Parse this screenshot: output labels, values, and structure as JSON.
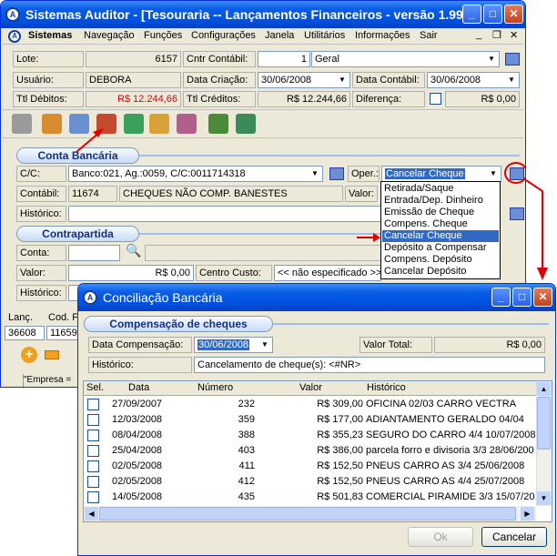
{
  "main": {
    "title": "Sistemas Auditor - [Tesouraria -- Lançamentos Financeiros - versão 1.99]",
    "menu": [
      "Sistemas",
      "Navegação",
      "Funções",
      "Configurações",
      "Janela",
      "Utilitários",
      "Informações",
      "Sair"
    ],
    "lote_label": "Lote:",
    "lote_value": "6157",
    "cntr_label": "Cntr Contábil:",
    "cntr_num": "1",
    "cntr_value": "Geral",
    "usuario_label": "Usuário:",
    "usuario_value": "DEBORA",
    "criacao_label": "Data Criação:",
    "criacao_value": "30/06/2008",
    "contabil_date_label": "Data Contábil:",
    "contabil_date_value": "30/06/2008",
    "debitos_label": "Ttl Débitos:",
    "debitos_value": "R$ 12.244,66",
    "creditos_label": "Ttl Créditos:",
    "creditos_value": "R$ 12.244,66",
    "diferenca_label": "Diferença:",
    "diferenca_value": "R$ 0,00",
    "conta_bancaria_title": "Conta Bancária",
    "cc_label": "C/C:",
    "cc_value": "Banco:021, Ag.:0059, C/C:0011714318",
    "oper_label": "Oper.:",
    "oper_value": "Cancelar Cheque",
    "contabil_label": "Contábil:",
    "contabil_code": "11674",
    "contabil_desc": "CHEQUES NÃO COMP. BANESTES",
    "valor_label": "Valor:",
    "historico_label": "Histórico:",
    "contrapartida_title": "Contrapartida",
    "conta_label": "Conta:",
    "cp_valor_label": "Valor:",
    "cp_valor_value": "R$ 0,00",
    "centro_label": "Centro Custo:",
    "centro_value": "<< não especificado >>",
    "cp_historico_label": "Histórico:",
    "grid_headers": [
      "Lanç.",
      "Cod. F"
    ],
    "grid_values": [
      "36608",
      "11659"
    ],
    "status_text": "\"Empresa ="
  },
  "dropdown": {
    "options": [
      "Retirada/Saque",
      "Entrada/Dep. Dinheiro",
      "Emissão de Cheque",
      "Compens. Cheque",
      "Cancelar Cheque",
      "Depósito a Compensar",
      "Compens. Depósito",
      "Cancelar Depósito"
    ],
    "selected_index": 4
  },
  "dialog": {
    "title": "Conciliação Bancária",
    "section_title": "Compensação  de cheques",
    "data_comp_label": "Data Compensação:",
    "data_comp_value": "30/06/2008",
    "valor_total_label": "Valor Total:",
    "valor_total_value": "R$ 0,00",
    "historico_label": "Histórico:",
    "historico_value": "Cancelamento de cheque(s): <#NR>",
    "columns": [
      "Sel.",
      "Data",
      "Número",
      "Valor",
      "Histórico"
    ],
    "rows": [
      {
        "data": "27/09/2007",
        "numero": "232",
        "valor": "R$ 309,00",
        "historico": "OFICINA 02/03 CARRO VECTRA"
      },
      {
        "data": "12/03/2008",
        "numero": "359",
        "valor": "R$ 177,00",
        "historico": "ADIANTAMENTO   GERALDO 04/04"
      },
      {
        "data": "08/04/2008",
        "numero": "388",
        "valor": "R$ 355,23",
        "historico": "SEGURO DO CARRO 4/4  10/07/2008"
      },
      {
        "data": "25/04/2008",
        "numero": "403",
        "valor": "R$ 386,00",
        "historico": "parcela forro e divisoria 3/3  28/06/200"
      },
      {
        "data": "02/05/2008",
        "numero": "411",
        "valor": "R$ 152,50",
        "historico": "PNEUS CARRO AS  3/4  25/06/2008"
      },
      {
        "data": "02/05/2008",
        "numero": "412",
        "valor": "R$ 152,50",
        "historico": "PNEUS CARRO AS  4/4  25/07/2008"
      },
      {
        "data": "14/05/2008",
        "numero": "435",
        "valor": "R$ 501,83",
        "historico": "COMERCIAL PIRAMIDE 3/3 15/07/200"
      }
    ],
    "ok_label": "Ok",
    "cancel_label": "Cancelar"
  },
  "colors": {
    "titlebar": "#0052e0",
    "debitos": "#e00000",
    "selection": "#316ac5",
    "arrow": "#e00000"
  }
}
